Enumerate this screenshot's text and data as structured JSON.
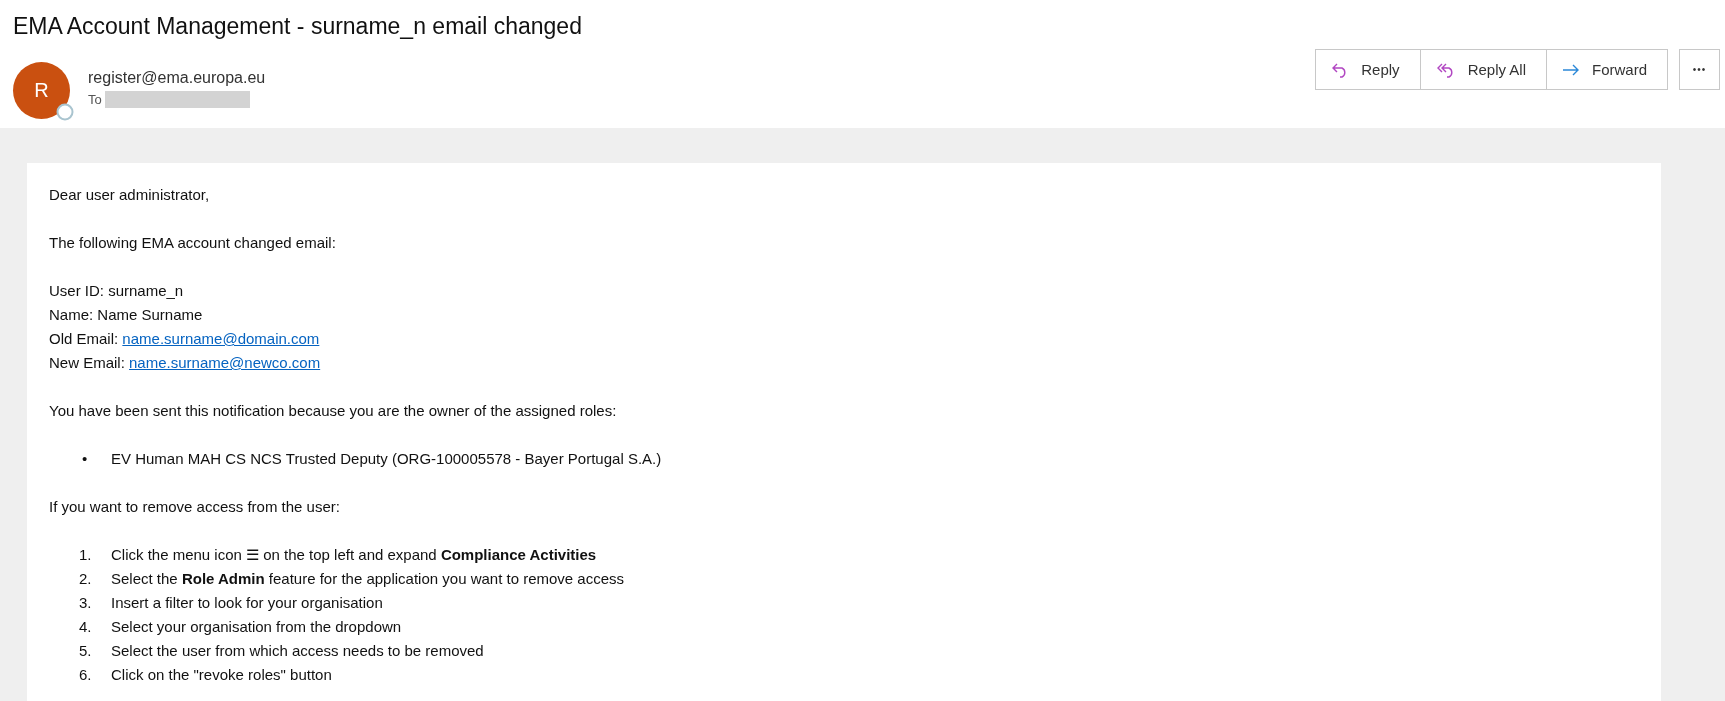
{
  "message": {
    "subject": "EMA Account Management - surname_n email changed",
    "sender": {
      "initial": "R",
      "address": "register@ema.europa.eu",
      "to_label": "To"
    },
    "actions": [
      {
        "kind": "reply",
        "label": "Reply"
      },
      {
        "kind": "reply_all",
        "label": "Reply All"
      },
      {
        "kind": "forward",
        "label": "Forward"
      }
    ],
    "more": "•••"
  },
  "body": [
    {
      "kind": "text",
      "text": "Dear user administrator,"
    },
    {
      "kind": "text",
      "text": "The following EMA account changed email:"
    },
    {
      "kind": "fields",
      "lines": [
        {
          "label": "User ID: surname_n"
        },
        {
          "label": "Name: Name Surname"
        },
        {
          "label": "Old Email: ",
          "link": "name.surname@domain.com"
        },
        {
          "label": "New Email: ",
          "link": "name.surname@newco.com"
        }
      ]
    },
    {
      "kind": "text",
      "text": "You have been sent this notification because you are the owner of the assigned roles:"
    },
    {
      "kind": "bullets",
      "items": [
        {
          "marker": "•",
          "text": "EV Human MAH CS NCS Trusted Deputy (ORG-100005578 - Bayer Portugal S.A.)"
        }
      ]
    },
    {
      "kind": "text",
      "text": "If you want to remove access from the user:"
    },
    {
      "kind": "steps",
      "items": [
        {
          "number": "1.",
          "text": "Click the menu icon ☰ on the top left and expand **Compliance Activities**"
        },
        {
          "number": "2.",
          "text": "Select the **Role Admin** feature for the application you want to remove access"
        },
        {
          "number": "3.",
          "text": "Insert a filter to look for your organisation"
        },
        {
          "number": "4.",
          "text": "Select your organisation from the dropdown"
        },
        {
          "number": "5.",
          "text": "Select the user from which access needs to be removed"
        },
        {
          "number": "6.",
          "text": "Click on the \"revoke roles\" button"
        }
      ]
    }
  ]
}
